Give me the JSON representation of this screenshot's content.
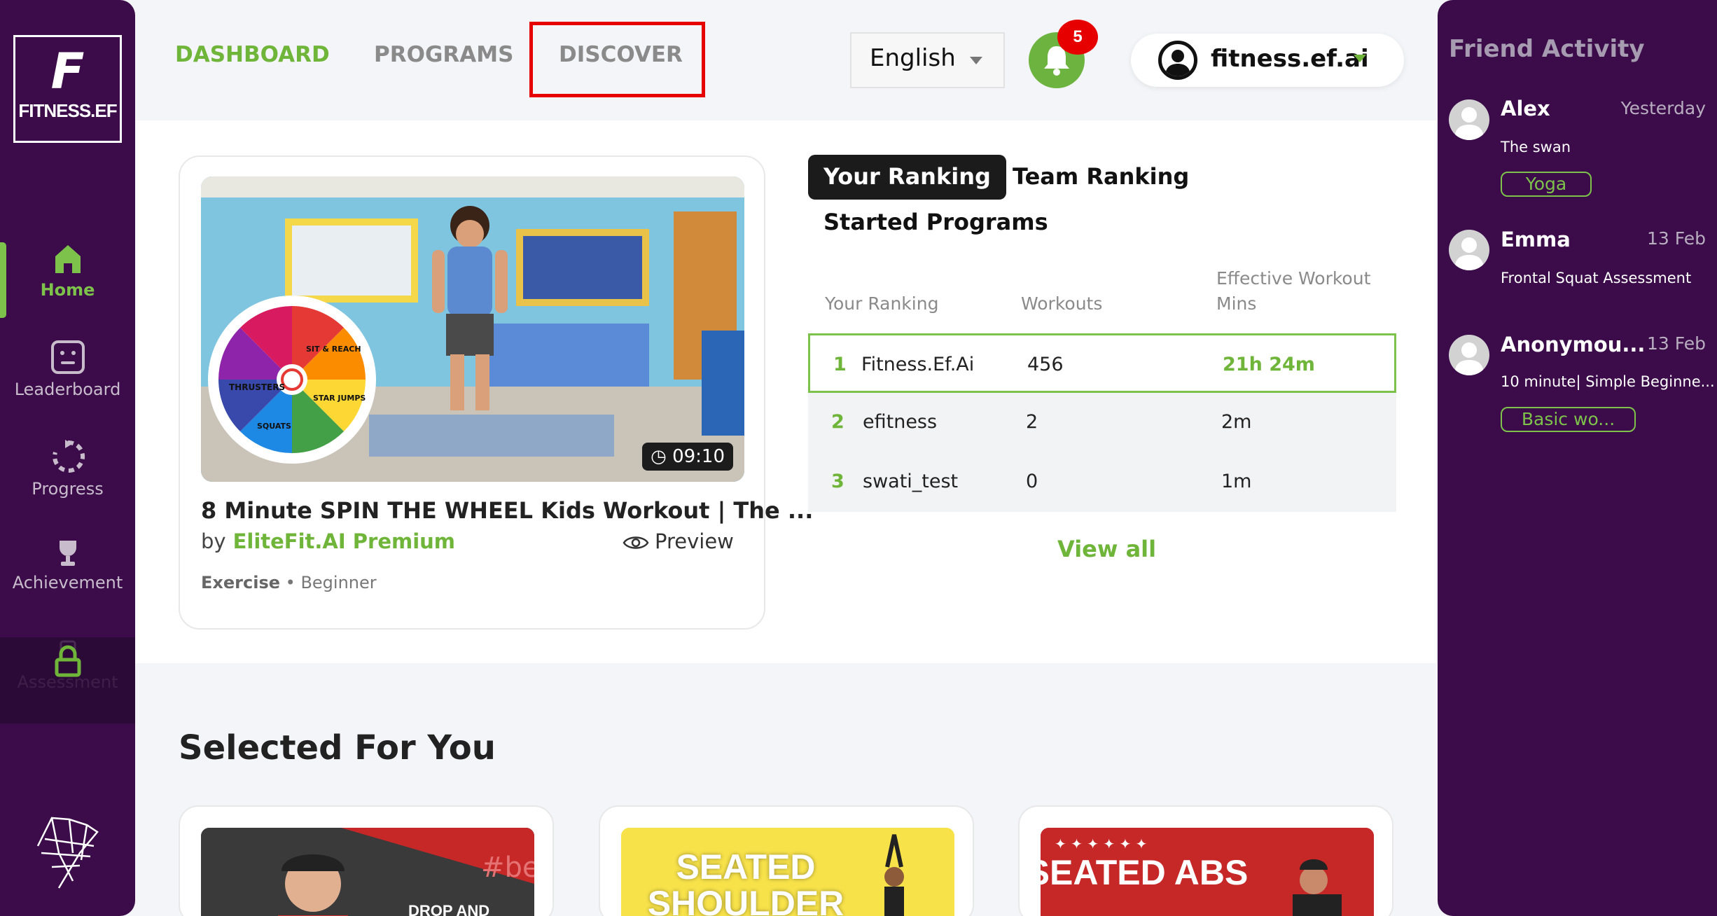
{
  "sidebar": {
    "logo_letter": "F",
    "logo_text": "FITNESS.EF",
    "items": [
      {
        "label": "Home"
      },
      {
        "label": "Leaderboard"
      },
      {
        "label": "Progress"
      },
      {
        "label": "Achievement"
      },
      {
        "label": "Assessment"
      }
    ]
  },
  "topnav": {
    "tabs": [
      {
        "label": "DASHBOARD"
      },
      {
        "label": "PROGRAMS"
      },
      {
        "label": "DISCOVER"
      }
    ],
    "language": "English",
    "notification_count": "5",
    "username": "fitness.ef.ai"
  },
  "featured": {
    "title": "8 Minute SPIN THE WHEEL Kids Workout | The ...",
    "by_label": "by",
    "author": "EliteFit.AI Premium",
    "preview_label": "Preview",
    "duration": "09:10",
    "category": "Exercise",
    "level": "• Beginner",
    "wheel_labels": [
      "THRUSTERS",
      "SIT & REACH",
      "STAR JUMPS",
      "SQUATS"
    ]
  },
  "ranking": {
    "tabs": [
      {
        "label": "Your Ranking"
      },
      {
        "label": "Team Ranking"
      },
      {
        "label": "Started Programs"
      }
    ],
    "columns": [
      "Your Ranking",
      "Workouts",
      "Effective Workout Mins"
    ],
    "rows": [
      {
        "rank": "1",
        "name": "Fitness.Ef.Ai",
        "workouts": "456",
        "mins": "21h 24m"
      },
      {
        "rank": "2",
        "name": "efitness",
        "workouts": "2",
        "mins": "2m"
      },
      {
        "rank": "3",
        "name": "swati_test",
        "workouts": "0",
        "mins": "1m"
      }
    ],
    "view_all": "View all"
  },
  "selected": {
    "title": "Selected For You",
    "cards": [
      {
        "text": "DROP AND",
        "bg_text": "#be"
      },
      {
        "text": "SEATED SHOULDER"
      },
      {
        "text": "SEATED ABS"
      }
    ]
  },
  "friend_activity": {
    "title": "Friend Activity",
    "items": [
      {
        "name": "Alex",
        "date": "Yesterday",
        "activity": "The swan",
        "tag": "Yoga"
      },
      {
        "name": "Emma",
        "date": "13 Feb",
        "activity": "Frontal Squat Assessment",
        "tag": ""
      },
      {
        "name": "Anonymou...",
        "date": "13 Feb",
        "activity": "10 minute| Simple Beginne...",
        "tag": "Basic wo..."
      }
    ]
  },
  "colors": {
    "sidebar": "#3b0b4a",
    "accent": "#6fb53a",
    "highlight": "#e60000"
  }
}
